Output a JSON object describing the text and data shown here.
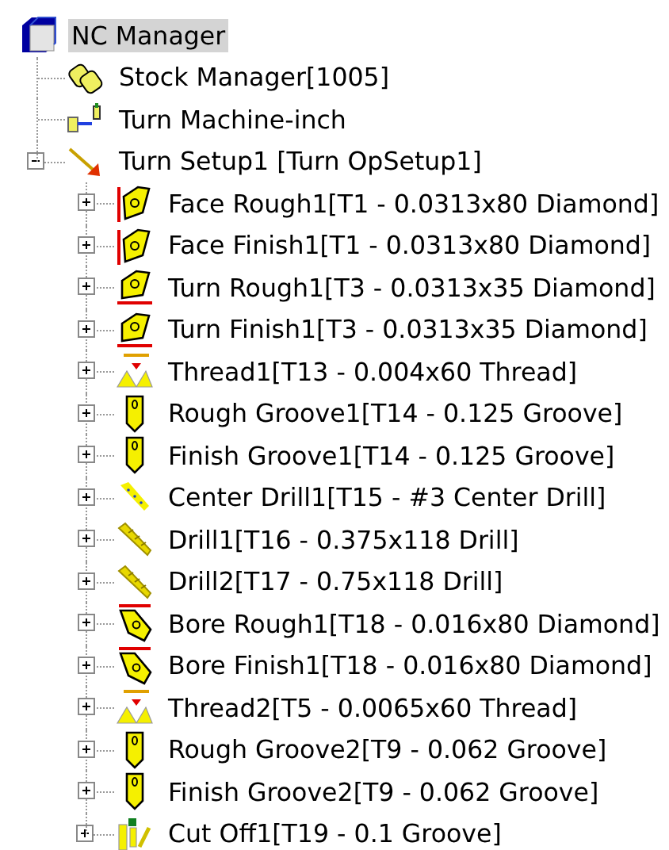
{
  "tree": {
    "label": "NC Manager",
    "kind": "nc-manager",
    "selected": true,
    "children": [
      {
        "label": "Stock Manager[1005]",
        "kind": "stock",
        "selected": false
      },
      {
        "label": "Turn Machine-inch",
        "kind": "machine",
        "selected": false
      },
      {
        "label": "Turn Setup1 [Turn OpSetup1]",
        "kind": "setup",
        "selected": false,
        "expanded": true,
        "children": [
          {
            "label": "Face Rough1[T1 - 0.0313x80 Diamond]",
            "kind": "face-insert",
            "selected": false,
            "expanded": false
          },
          {
            "label": "Face Finish1[T1 - 0.0313x80 Diamond]",
            "kind": "face-insert",
            "selected": false,
            "expanded": false
          },
          {
            "label": "Turn Rough1[T3 - 0.0313x35 Diamond]",
            "kind": "turn-insert",
            "selected": false,
            "expanded": false
          },
          {
            "label": "Turn Finish1[T3 - 0.0313x35 Diamond]",
            "kind": "turn-insert",
            "selected": false,
            "expanded": false
          },
          {
            "label": "Thread1[T13 - 0.004x60 Thread]",
            "kind": "thread",
            "selected": false,
            "expanded": false
          },
          {
            "label": "Rough Groove1[T14 - 0.125 Groove]",
            "kind": "groove",
            "selected": false,
            "expanded": false
          },
          {
            "label": "Finish Groove1[T14 - 0.125 Groove]",
            "kind": "groove",
            "selected": false,
            "expanded": false
          },
          {
            "label": "Center Drill1[T15 - #3 Center Drill]",
            "kind": "center-drill",
            "selected": false,
            "expanded": false
          },
          {
            "label": "Drill1[T16 - 0.375x118 Drill]",
            "kind": "drill",
            "selected": false,
            "expanded": false
          },
          {
            "label": "Drill2[T17 - 0.75x118 Drill]",
            "kind": "drill",
            "selected": false,
            "expanded": false
          },
          {
            "label": "Bore Rough1[T18 - 0.016x80 Diamond]",
            "kind": "bore-insert",
            "selected": false,
            "expanded": false
          },
          {
            "label": "Bore Finish1[T18 - 0.016x80 Diamond]",
            "kind": "bore-insert",
            "selected": false,
            "expanded": false
          },
          {
            "label": "Thread2[T5 - 0.0065x60 Thread]",
            "kind": "thread",
            "selected": false,
            "expanded": false
          },
          {
            "label": "Rough Groove2[T9 - 0.062 Groove]",
            "kind": "groove",
            "selected": false,
            "expanded": false
          },
          {
            "label": "Finish Groove2[T9 - 0.062 Groove]",
            "kind": "groove",
            "selected": false,
            "expanded": false
          },
          {
            "label": "Cut Off1[T19 - 0.1 Groove]",
            "kind": "cutoff",
            "selected": false,
            "expanded": false
          }
        ]
      }
    ]
  }
}
